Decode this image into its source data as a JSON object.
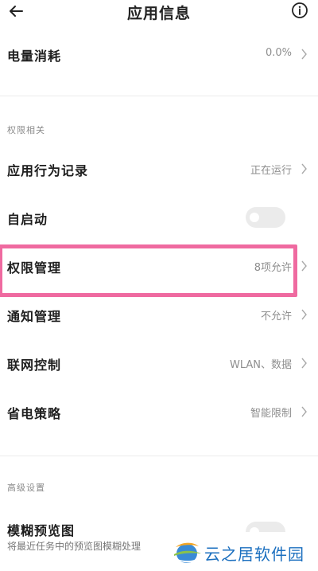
{
  "header": {
    "back_icon": "back-arrow-icon",
    "title": "应用信息",
    "info_icon": "info-icon"
  },
  "rows": {
    "battery": {
      "label": "电量消耗",
      "value": "0.0%"
    },
    "behavior": {
      "label": "应用行为记录",
      "value": "正在运行"
    },
    "autostart": {
      "label": "自启动",
      "toggle_on": false
    },
    "permissions": {
      "label": "权限管理",
      "value": "8项允许"
    },
    "notifications": {
      "label": "通知管理",
      "value": "不允许"
    },
    "network": {
      "label": "联网控制",
      "value": "WLAN、数据"
    },
    "power_saving": {
      "label": "省电策略",
      "value": "智能限制"
    },
    "blur_preview": {
      "label": "模糊预览图",
      "subtext": "将最近任务中的预览图模糊处理"
    }
  },
  "sections": {
    "permissions_related": "权限相关",
    "advanced": "高级设置"
  },
  "highlight_color": "#ef6aa0",
  "watermark": {
    "text": "云之居软件园",
    "color": "#1b6fbf"
  }
}
